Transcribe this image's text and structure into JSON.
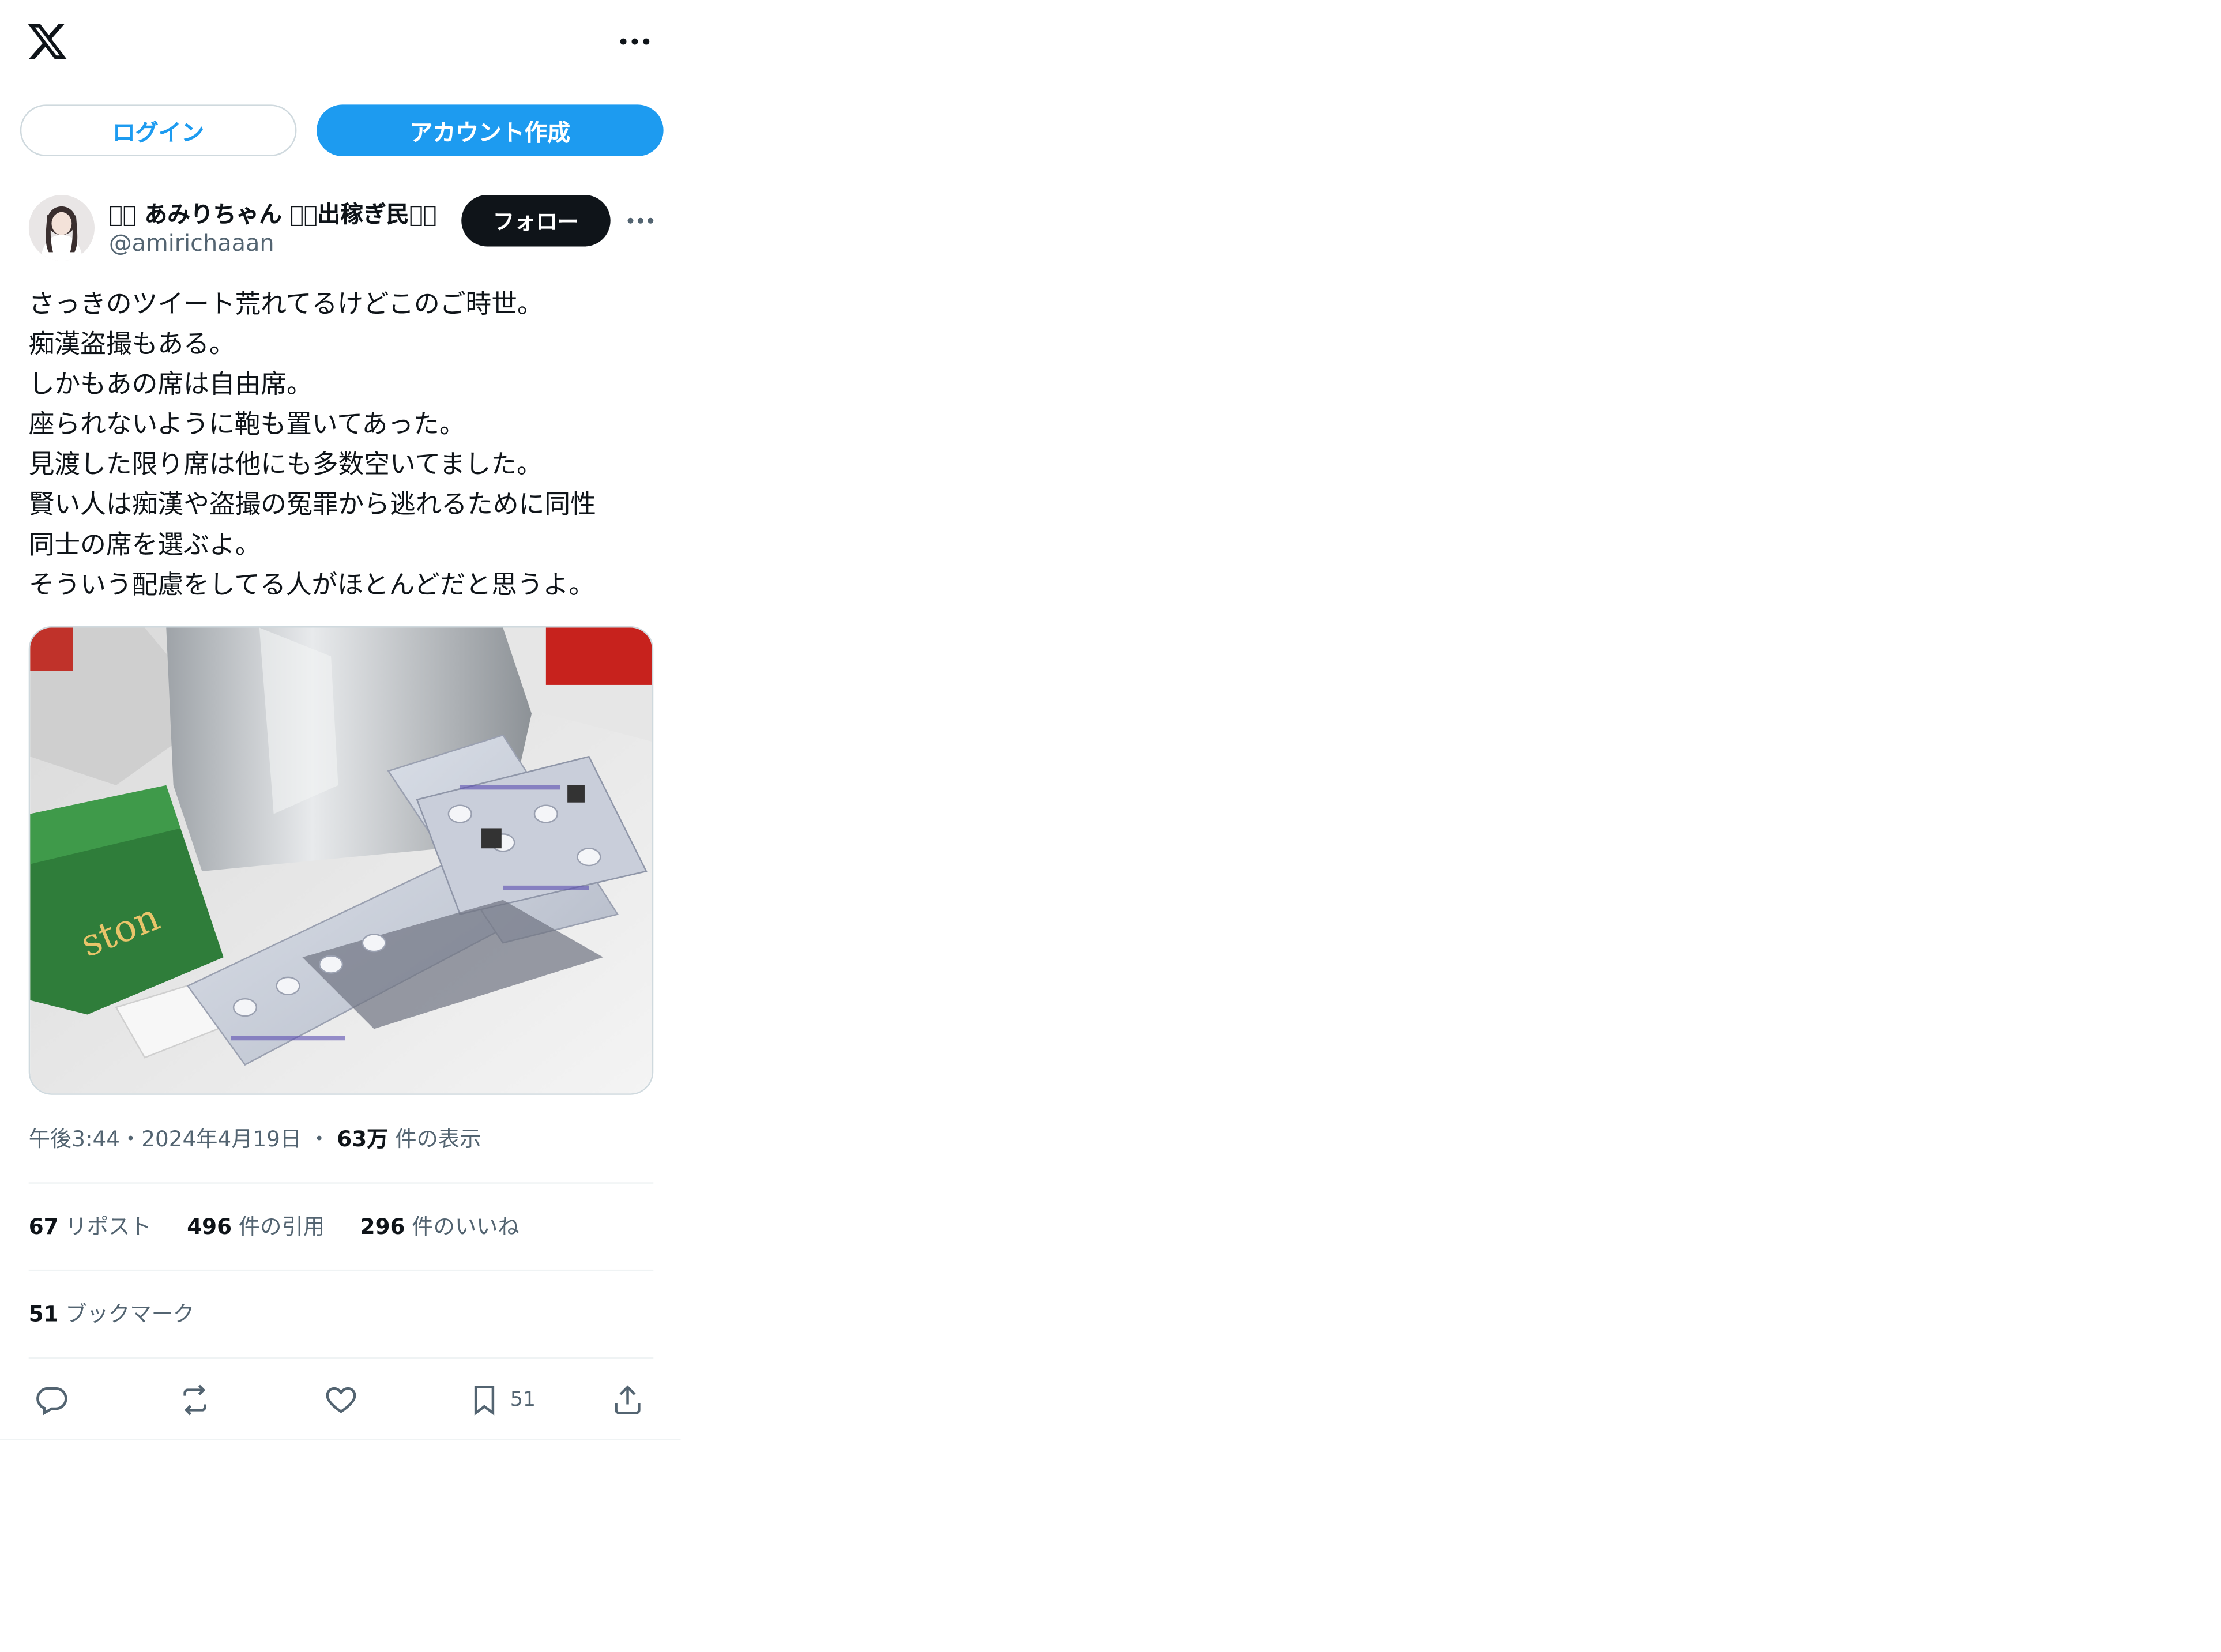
{
  "top_bar": {
    "logo_icon": "x-logo-icon",
    "more_icon": "more-horizontal-icon"
  },
  "auth": {
    "login_label": "ログイン",
    "signup_label": "アカウント作成"
  },
  "author": {
    "display_name": "􀀀􀀀 あみりちゃん 􀀀􀀀出稼ぎ民􀀀􀀀",
    "handle": "@amirichaaan",
    "follow_label": "フォロー"
  },
  "tweet": {
    "lines": [
      "さっきのツイート荒れてるけどこのご時世。",
      "痴漢盗撮もある。",
      "しかもあの席は自由席。",
      "座られないように鞄も置いてあった。",
      "見渡した限り席は他にも多数空いてました。",
      "賢い人は痴漢や盗撮の冤罪から逃れるために同性",
      "同士の席を選ぶよ。",
      "そういう配慮をしてる人がほとんどだと思うよ。"
    ]
  },
  "meta": {
    "time": "午後3:44",
    "sep1": "・",
    "date": "2024年4月19日",
    "sep2": "・",
    "views_value": "63万",
    "views_label": "件の表示"
  },
  "stats": {
    "reposts_value": "67",
    "reposts_label": "リポスト",
    "quotes_value": "496",
    "quotes_label": "件の引用",
    "likes_value": "296",
    "likes_label": "件のいいね",
    "bookmarks_value": "51",
    "bookmarks_label": "ブックマーク"
  },
  "actions": {
    "reply_icon": "reply-icon",
    "repost_icon": "repost-icon",
    "like_icon": "heart-icon",
    "bookmark_icon": "bookmark-icon",
    "bookmark_count": "51",
    "share_icon": "share-icon"
  },
  "colors": {
    "accent": "#1d9bf0",
    "text": "#0f1419",
    "secondary": "#536471",
    "border": "#cfd9de"
  }
}
